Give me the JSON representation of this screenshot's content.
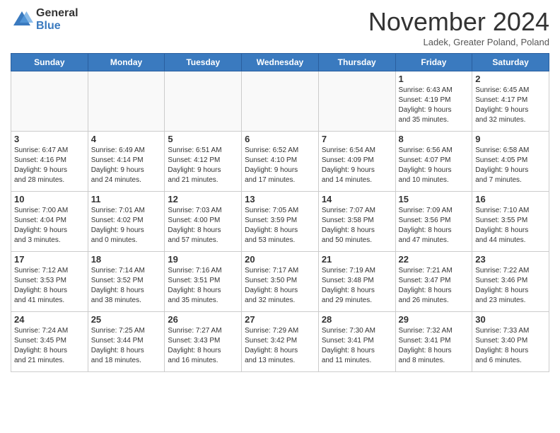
{
  "header": {
    "logo_general": "General",
    "logo_blue": "Blue",
    "title": "November 2024",
    "location": "Ladek, Greater Poland, Poland"
  },
  "days_of_week": [
    "Sunday",
    "Monday",
    "Tuesday",
    "Wednesday",
    "Thursday",
    "Friday",
    "Saturday"
  ],
  "weeks": [
    [
      {
        "day": "",
        "info": "",
        "empty": true
      },
      {
        "day": "",
        "info": "",
        "empty": true
      },
      {
        "day": "",
        "info": "",
        "empty": true
      },
      {
        "day": "",
        "info": "",
        "empty": true
      },
      {
        "day": "",
        "info": "",
        "empty": true
      },
      {
        "day": "1",
        "info": "Sunrise: 6:43 AM\nSunset: 4:19 PM\nDaylight: 9 hours\nand 35 minutes."
      },
      {
        "day": "2",
        "info": "Sunrise: 6:45 AM\nSunset: 4:17 PM\nDaylight: 9 hours\nand 32 minutes."
      }
    ],
    [
      {
        "day": "3",
        "info": "Sunrise: 6:47 AM\nSunset: 4:16 PM\nDaylight: 9 hours\nand 28 minutes."
      },
      {
        "day": "4",
        "info": "Sunrise: 6:49 AM\nSunset: 4:14 PM\nDaylight: 9 hours\nand 24 minutes."
      },
      {
        "day": "5",
        "info": "Sunrise: 6:51 AM\nSunset: 4:12 PM\nDaylight: 9 hours\nand 21 minutes."
      },
      {
        "day": "6",
        "info": "Sunrise: 6:52 AM\nSunset: 4:10 PM\nDaylight: 9 hours\nand 17 minutes."
      },
      {
        "day": "7",
        "info": "Sunrise: 6:54 AM\nSunset: 4:09 PM\nDaylight: 9 hours\nand 14 minutes."
      },
      {
        "day": "8",
        "info": "Sunrise: 6:56 AM\nSunset: 4:07 PM\nDaylight: 9 hours\nand 10 minutes."
      },
      {
        "day": "9",
        "info": "Sunrise: 6:58 AM\nSunset: 4:05 PM\nDaylight: 9 hours\nand 7 minutes."
      }
    ],
    [
      {
        "day": "10",
        "info": "Sunrise: 7:00 AM\nSunset: 4:04 PM\nDaylight: 9 hours\nand 3 minutes."
      },
      {
        "day": "11",
        "info": "Sunrise: 7:01 AM\nSunset: 4:02 PM\nDaylight: 9 hours\nand 0 minutes."
      },
      {
        "day": "12",
        "info": "Sunrise: 7:03 AM\nSunset: 4:00 PM\nDaylight: 8 hours\nand 57 minutes."
      },
      {
        "day": "13",
        "info": "Sunrise: 7:05 AM\nSunset: 3:59 PM\nDaylight: 8 hours\nand 53 minutes."
      },
      {
        "day": "14",
        "info": "Sunrise: 7:07 AM\nSunset: 3:58 PM\nDaylight: 8 hours\nand 50 minutes."
      },
      {
        "day": "15",
        "info": "Sunrise: 7:09 AM\nSunset: 3:56 PM\nDaylight: 8 hours\nand 47 minutes."
      },
      {
        "day": "16",
        "info": "Sunrise: 7:10 AM\nSunset: 3:55 PM\nDaylight: 8 hours\nand 44 minutes."
      }
    ],
    [
      {
        "day": "17",
        "info": "Sunrise: 7:12 AM\nSunset: 3:53 PM\nDaylight: 8 hours\nand 41 minutes."
      },
      {
        "day": "18",
        "info": "Sunrise: 7:14 AM\nSunset: 3:52 PM\nDaylight: 8 hours\nand 38 minutes."
      },
      {
        "day": "19",
        "info": "Sunrise: 7:16 AM\nSunset: 3:51 PM\nDaylight: 8 hours\nand 35 minutes."
      },
      {
        "day": "20",
        "info": "Sunrise: 7:17 AM\nSunset: 3:50 PM\nDaylight: 8 hours\nand 32 minutes."
      },
      {
        "day": "21",
        "info": "Sunrise: 7:19 AM\nSunset: 3:48 PM\nDaylight: 8 hours\nand 29 minutes."
      },
      {
        "day": "22",
        "info": "Sunrise: 7:21 AM\nSunset: 3:47 PM\nDaylight: 8 hours\nand 26 minutes."
      },
      {
        "day": "23",
        "info": "Sunrise: 7:22 AM\nSunset: 3:46 PM\nDaylight: 8 hours\nand 23 minutes."
      }
    ],
    [
      {
        "day": "24",
        "info": "Sunrise: 7:24 AM\nSunset: 3:45 PM\nDaylight: 8 hours\nand 21 minutes."
      },
      {
        "day": "25",
        "info": "Sunrise: 7:25 AM\nSunset: 3:44 PM\nDaylight: 8 hours\nand 18 minutes."
      },
      {
        "day": "26",
        "info": "Sunrise: 7:27 AM\nSunset: 3:43 PM\nDaylight: 8 hours\nand 16 minutes."
      },
      {
        "day": "27",
        "info": "Sunrise: 7:29 AM\nSunset: 3:42 PM\nDaylight: 8 hours\nand 13 minutes."
      },
      {
        "day": "28",
        "info": "Sunrise: 7:30 AM\nSunset: 3:41 PM\nDaylight: 8 hours\nand 11 minutes."
      },
      {
        "day": "29",
        "info": "Sunrise: 7:32 AM\nSunset: 3:41 PM\nDaylight: 8 hours\nand 8 minutes."
      },
      {
        "day": "30",
        "info": "Sunrise: 7:33 AM\nSunset: 3:40 PM\nDaylight: 8 hours\nand 6 minutes."
      }
    ]
  ]
}
